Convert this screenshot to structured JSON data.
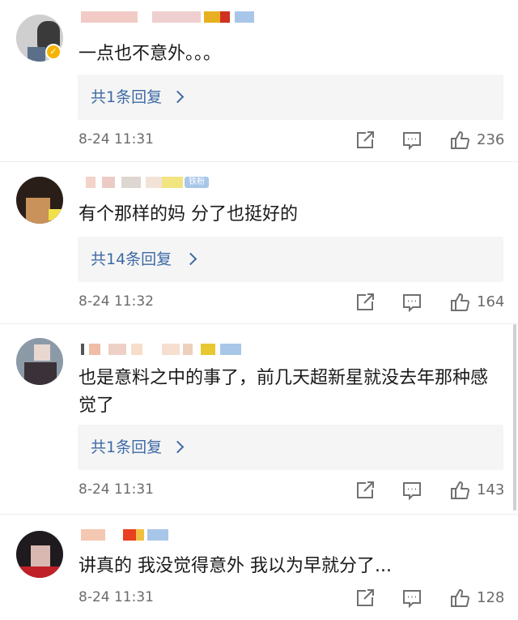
{
  "comments": [
    {
      "text": "一点也不意外。。。",
      "replies": "共1条回复",
      "time": "8-24 11:31",
      "likes": "236"
    },
    {
      "text": "有个那样的妈 分了也挺好的",
      "replies": "共14条回复",
      "time": "8-24 11:32",
      "likes": "164",
      "badge": "铁粉"
    },
    {
      "text": "也是意料之中的事了，前几天超新星就没去年那种感觉了",
      "replies": "共1条回复",
      "time": "8-24 11:31",
      "likes": "143"
    },
    {
      "text": "讲真的 我没觉得意外 我以为早就分了...",
      "time": "8-24 11:31",
      "likes": "128"
    }
  ],
  "icons": {
    "share": "share-icon",
    "comment": "comment-icon",
    "like": "thumbs-up-icon"
  },
  "colors": {
    "link_blue": "#3e6aa5",
    "reply_bg": "#f5f5f5",
    "meta_gray": "#6b6b6b",
    "verified_gold": "#f6b400"
  }
}
